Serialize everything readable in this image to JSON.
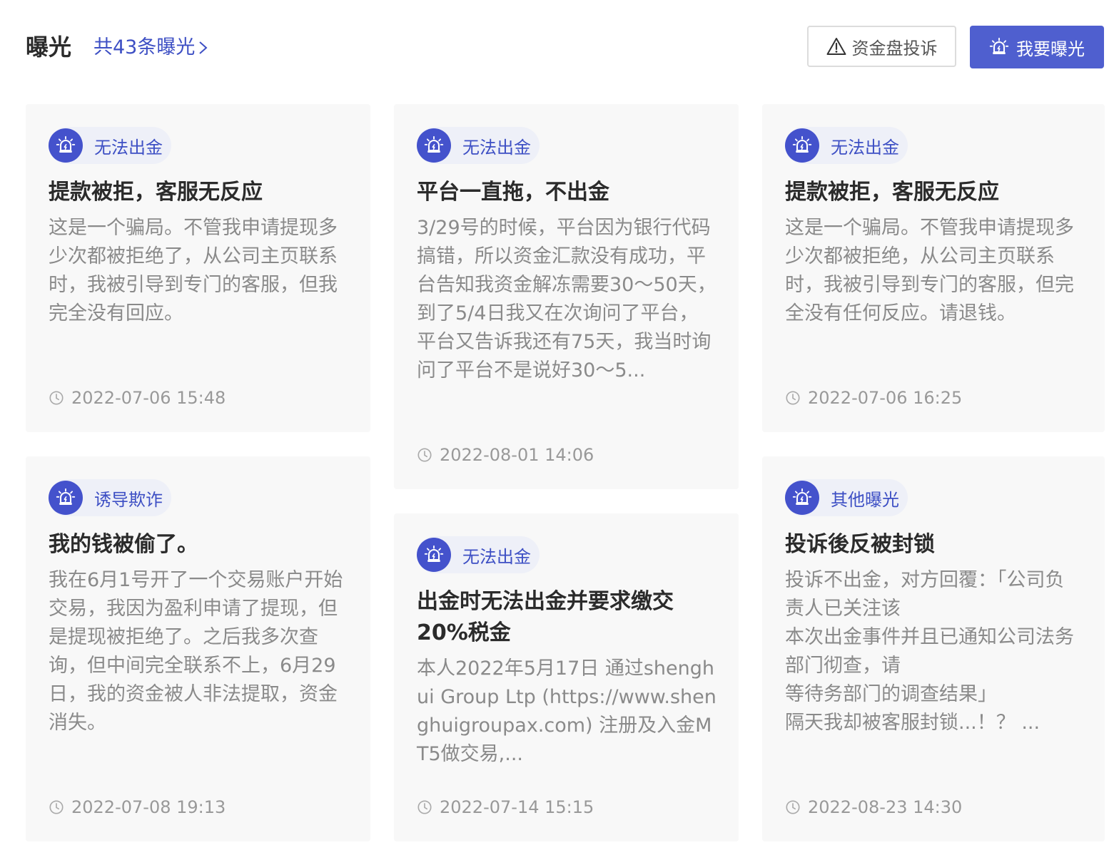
{
  "header": {
    "title": "曝光",
    "count_link": "共43条曝光",
    "complain_button": "资金盘投诉",
    "expose_button": "我要曝光"
  },
  "colors": {
    "accent": "#4f5fcf",
    "link": "#3d4fc4",
    "card_bg": "#f8f8f8",
    "tag_bg": "#eef0f8"
  },
  "icons": {
    "tag": "alarm-siren-icon",
    "time": "clock-icon",
    "count": "chevron-right-icon",
    "complain": "warning-triangle-icon",
    "expose": "alarm-siren-icon"
  },
  "cards": [
    {
      "tag": "无法出金",
      "title": "提款被拒，客服无反应",
      "body": "这是一个骗局。不管我申请提现多少次都被拒绝了，从公司主页联系时，我被引导到专门的客服，但我完全没有回应。",
      "time": "2022-07-06 15:48"
    },
    {
      "tag": "无法出金",
      "title": "平台一直拖，不出金",
      "body": "3/29号的时候，平台因为银行代码搞错，所以资金汇款没有成功，平台告知我资金解冻需要30～50天，到了5/4日我又在次询问了平台，平台又告诉我还有75天，我当时询问了平台不是说好30～5...",
      "time": "2022-08-01 14:06"
    },
    {
      "tag": "无法出金",
      "title": "提款被拒，客服无反应",
      "body": "这是一个骗局。不管我申请提现多少次都被拒绝，从公司主页联系时，我被引导到专门的客服，但完全没有任何反应。请退钱。",
      "time": "2022-07-06 16:25"
    },
    {
      "tag": "诱导欺诈",
      "title": "我的钱被偷了。",
      "body": "我在6月1号开了一个交易账户开始交易，我因为盈利申请了提现，但是提现被拒绝了。之后我多次查询，但中间完全联系不上，6月29日，我的资金被人非法提取，资金消失。",
      "time": "2022-07-08 19:13"
    },
    {
      "tag": "无法出金",
      "title": "出金时无法出金并要求缴交20%税金",
      "body": "本人2022年5月17日 通过shenghui Group Ltp (https://www.shenghuigroupax.com) 注册及入金MT5做交易,...",
      "time": "2022-07-14 15:15"
    },
    {
      "tag": "其他曝光",
      "title": "投诉後反被封锁",
      "body_lines": [
        "投诉不出金，对方回覆：「公司负责人已关注该",
        "本次出金事件并且已通知公司法务部门彻查，请",
        "等待务部门的调查结果」",
        "隔天我却被客服封锁...！？ ..."
      ],
      "time": "2022-08-23 14:30"
    }
  ]
}
